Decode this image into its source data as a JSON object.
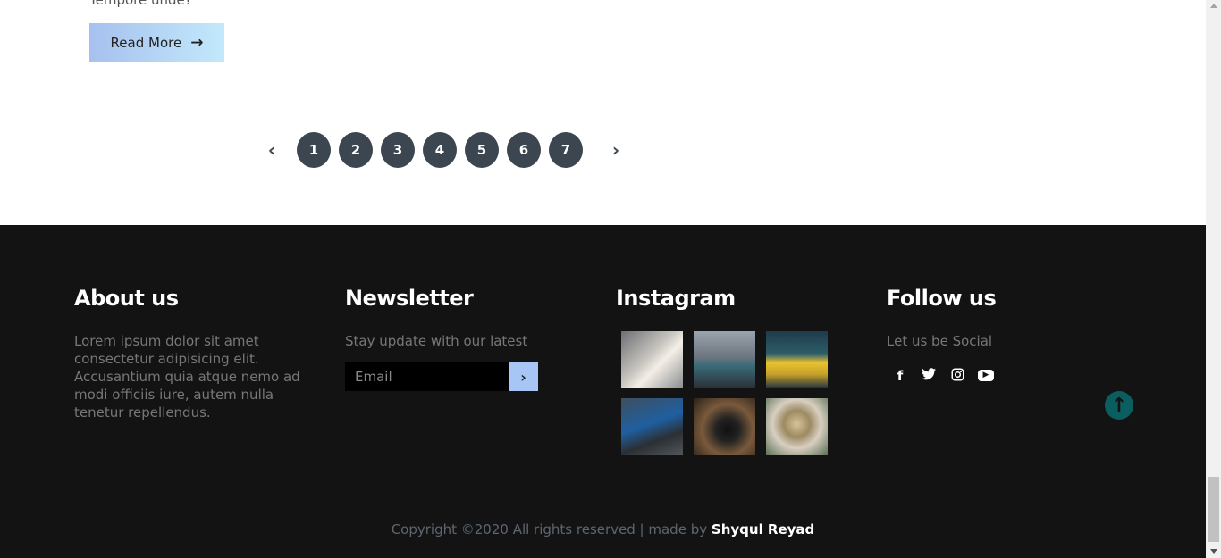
{
  "post": {
    "excerpt_tail": "Tempore unde?",
    "read_more_label": "Read More",
    "read_more_icon": "arrow-right-icon"
  },
  "pagination": {
    "prev_icon": "chevron-left-icon",
    "next_icon": "chevron-right-icon",
    "pages": [
      "1",
      "2",
      "3",
      "4",
      "5",
      "6",
      "7"
    ]
  },
  "footer": {
    "about": {
      "title": "About us",
      "text": "Lorem ipsum dolor sit amet consectetur adipisicing elit. Accusantium quia atque nemo ad modi officiis iure, autem nulla tenetur repellendus."
    },
    "newsletter": {
      "title": "Newsletter",
      "text": "Stay update with our latest",
      "email_placeholder": "Email",
      "submit_icon": "chevron-right-icon"
    },
    "instagram": {
      "title": "Instagram",
      "images": [
        "white-puppy-photo",
        "woman-sitting-city-photo",
        "man-yellow-shirt-photo",
        "blue-car-photo",
        "camera-lens-photo",
        "hand-compass-photo"
      ]
    },
    "follow": {
      "title": "Follow us",
      "text": "Let us be Social",
      "icons": [
        "facebook-icon",
        "twitter-icon",
        "instagram-icon",
        "youtube-icon"
      ]
    },
    "scroll_top_icon": "arrow-up-circle-icon",
    "copyright": {
      "text": "Copyright ©2020 All rights reserved | made by",
      "author": "Shyqul Reyad"
    }
  },
  "colors": {
    "footer_bg": "#131313",
    "page_button": "#3b4650",
    "read_more_gradient_start": "#a6c1ee",
    "read_more_gradient_end": "#c2e9fb",
    "newsletter_button": "#a8c6f5",
    "scroll_top": "#0a5e60"
  }
}
